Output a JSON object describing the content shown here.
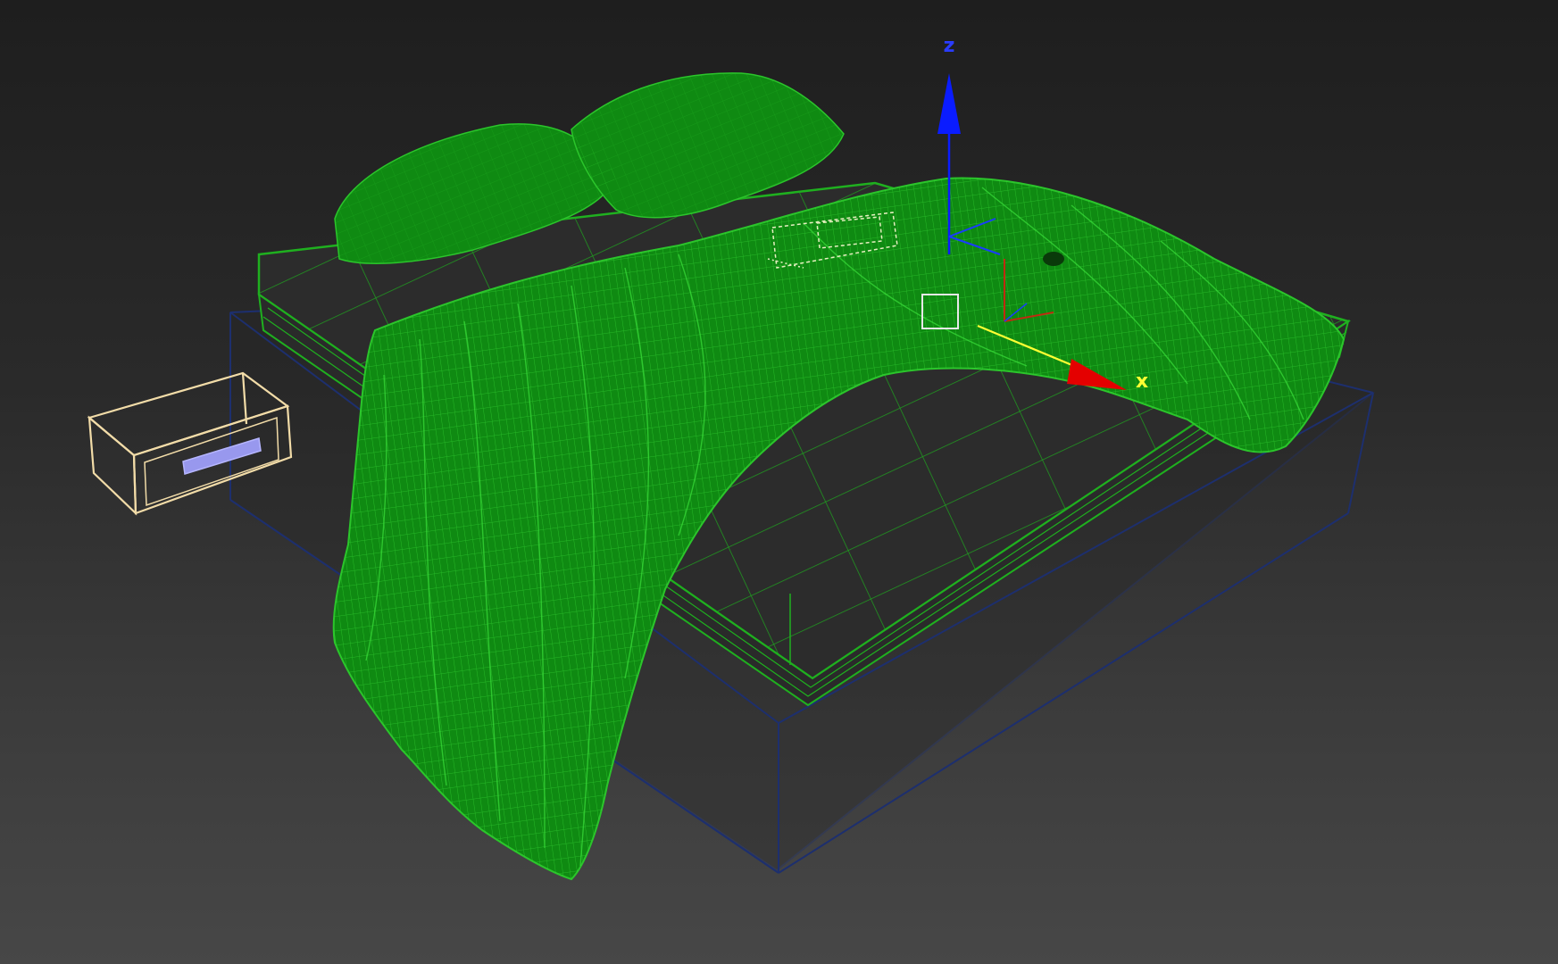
{
  "viewport": {
    "background_top": "#1e1e1e",
    "background_bottom": "#474747"
  },
  "gizmo": {
    "x_label": "x",
    "z_label": "z",
    "x_color": "#ffff33",
    "y_color": "#00a000",
    "z_color": "#0a1cff",
    "x_arrow_color": "#e40000",
    "local_x_color": "#c02a10",
    "local_z_color": "#1a3cff",
    "pivot_box_color": "#e8e8e8"
  },
  "objects": {
    "blanket_color": "#0f8a12",
    "blanket_wire_color": "#2bc52b",
    "mattress_wire_color": "#1fb01f",
    "bed_base_color": "#1d2f6e",
    "nightstand_color": "#f2dca8",
    "nightstand_handle_color": "#9898ee",
    "selection_highlight_color": "#e6f0c0"
  }
}
